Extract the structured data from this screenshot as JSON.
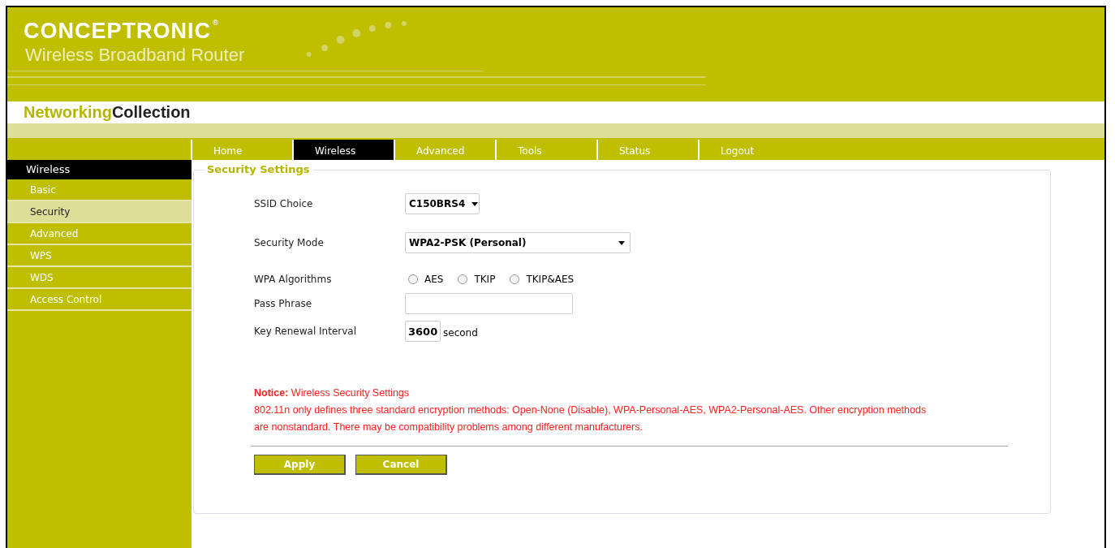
{
  "header": {
    "brand": "CONCEPTRONIC",
    "brand_mark": "®",
    "product": "Wireless Broadband Router",
    "collection_left": "Networking",
    "collection_right": "Collection"
  },
  "tabs": [
    {
      "label": "Home",
      "selected": false
    },
    {
      "label": "Wireless",
      "selected": true
    },
    {
      "label": "Advanced",
      "selected": false
    },
    {
      "label": "Tools",
      "selected": false
    },
    {
      "label": "Status",
      "selected": false
    },
    {
      "label": "Logout",
      "selected": false
    }
  ],
  "sidebar": {
    "heading": "Wireless",
    "items": [
      {
        "label": "Basic",
        "selected": false
      },
      {
        "label": "Security",
        "selected": true
      },
      {
        "label": "Advanced",
        "selected": false
      },
      {
        "label": "WPS",
        "selected": false
      },
      {
        "label": "WDS",
        "selected": false
      },
      {
        "label": "Access Control",
        "selected": false
      }
    ]
  },
  "panel": {
    "title": "Security Settings",
    "ssid": {
      "label": "SSID Choice",
      "value": "C150BRS4"
    },
    "mode": {
      "label": "Security Mode",
      "value": "WPA2-PSK (Personal)"
    },
    "algorithms": {
      "label": "WPA Algorithms",
      "options": [
        {
          "label": "AES",
          "selected": false
        },
        {
          "label": "TKIP",
          "selected": false
        },
        {
          "label": "TKIP&AES",
          "selected": false
        }
      ]
    },
    "pass_phrase": {
      "label": "Pass Phrase"
    },
    "renewal": {
      "label": "Key Renewal Interval",
      "value": "3600",
      "unit": "second"
    },
    "notice": "**Notice:** Wireless Security Settings",
    "notice_text": "802.11n only defines three standard encryption methods: Open-None (Disable), WPA-Personal-AES, WPA2-Personal-AES. Other encryption methods are nonstandard. There may be compatibility problems among different manufacturers.",
    "buttons": [
      "Apply",
      "Cancel"
    ]
  }
}
